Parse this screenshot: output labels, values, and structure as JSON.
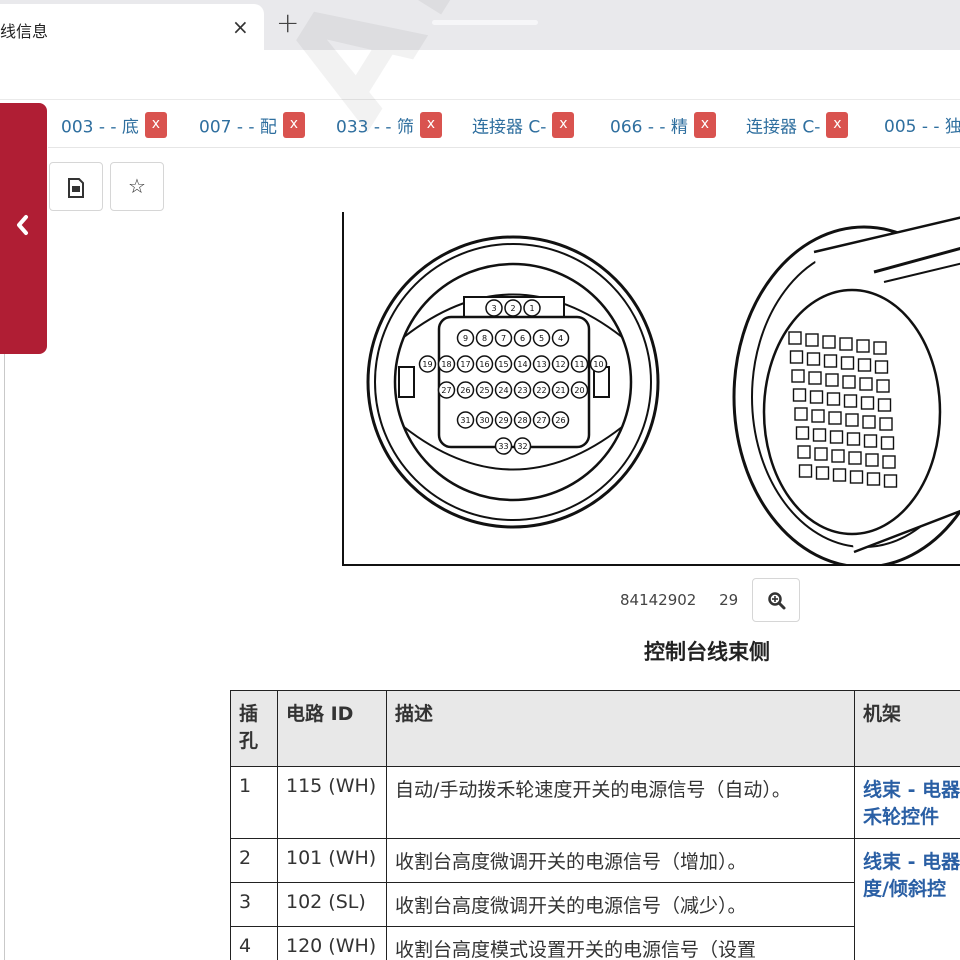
{
  "browser": {
    "tab_title": "线信息",
    "tab_close": "×",
    "new_tab": "+"
  },
  "doc_tabs": [
    {
      "label": "003 - - 底",
      "close": "x"
    },
    {
      "label": "007 - - 配",
      "close": "x"
    },
    {
      "label": "033 - - 筛",
      "close": "x"
    },
    {
      "label": "连接器 C-",
      "close": "x"
    },
    {
      "label": "066 - - 精",
      "close": "x"
    },
    {
      "label": "连接器 C-",
      "close": "x"
    },
    {
      "label": "005 - - 独",
      "close": "x"
    }
  ],
  "actions": {
    "pdf_icon": "document-icon",
    "favorite_icon": "star-icon",
    "favorite_glyph": "☆"
  },
  "figure": {
    "part_number": "84142902",
    "page": "29",
    "title": "控制台线束侧",
    "pin_labels": [
      "3",
      "2",
      "1",
      "9",
      "8",
      "7",
      "6",
      "5",
      "4",
      "19",
      "18",
      "17",
      "16",
      "15",
      "14",
      "13",
      "12",
      "11",
      "10",
      "27",
      "26",
      "25",
      "24",
      "23",
      "22",
      "21",
      "20",
      "31",
      "30",
      "29",
      "28",
      "27",
      "26",
      "33",
      "32"
    ]
  },
  "watermark": "AKOSI",
  "table": {
    "headers": [
      "插孔",
      "电路 ID",
      "描述",
      "机架"
    ],
    "rows": [
      {
        "pin": "1",
        "circuit": "115 (WH)",
        "desc": "自动/手动拨禾轮速度开关的电源信号（自动）。",
        "rack": "线束 - 电器 禾轮控件"
      },
      {
        "pin": "2",
        "circuit": "101 (WH)",
        "desc": "收割台高度微调开关的电源信号（增加）。",
        "rack": "线束 - 电器 度/倾斜控"
      },
      {
        "pin": "3",
        "circuit": "102 (SL)",
        "desc": "收割台高度微调开关的电源信号（减少）。",
        "rack": ""
      },
      {
        "pin": "4",
        "circuit": "120 (WH)",
        "desc": "收割台高度模式设置开关的电源信号（设置",
        "rack": ""
      }
    ]
  },
  "colors": {
    "side_tab": "#b01e34",
    "chip_close": "#d9534f",
    "link": "#2f6f9f",
    "rack_link": "#2a5fa4"
  }
}
